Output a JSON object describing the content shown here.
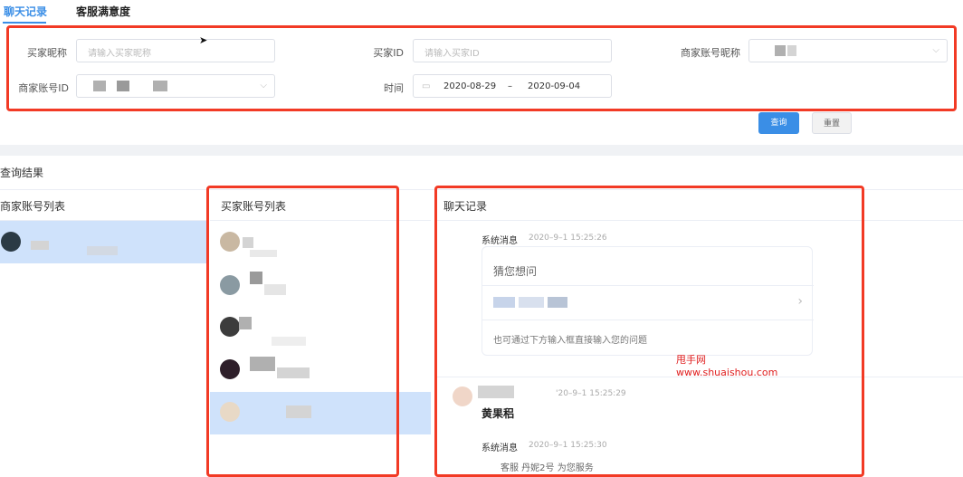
{
  "tabs": [
    {
      "label": "聊天记录",
      "active": true
    },
    {
      "label": "客服满意度",
      "active": false
    }
  ],
  "filters": {
    "buyer_nickname_label": "买家昵称",
    "buyer_nickname_placeholder": "请输入买家昵称",
    "buyer_id_label": "买家ID",
    "buyer_id_placeholder": "请输入买家ID",
    "merchant_account_nickname_label": "商家账号昵称",
    "merchant_account_id_label": "商家账号ID",
    "time_label": "时间",
    "date_start": "2020-08-29",
    "date_separator": "–",
    "date_end": "2020-09-04"
  },
  "buttons": {
    "query": "查询",
    "reset": "重置"
  },
  "results": {
    "title": "查询结果",
    "merchant_list_title": "商家账号列表",
    "buyer_list_title": "买家账号列表",
    "chat_title": "聊天记录"
  },
  "chat": {
    "system_label_1": "系统消息",
    "system_time_1": "2020–9–1 15:25:26",
    "guess_title": "猜您想问",
    "hint_text": "也可通过下方输入框直接输入您的问题",
    "buyer_time": "'20–9–1 15:25:29",
    "buyer_message": "黄果稆",
    "system_label_2": "系统消息",
    "system_time_2": "2020–9–1 15:25:30",
    "service_text": "客服 丹妮2号 为您服务"
  },
  "watermark": {
    "line1": "甩手网",
    "line2": "www.shuaishou.com"
  },
  "colors": {
    "accent": "#3a8ee6",
    "highlight_box": "#f23a25",
    "selected_row": "#cfe2fb"
  }
}
